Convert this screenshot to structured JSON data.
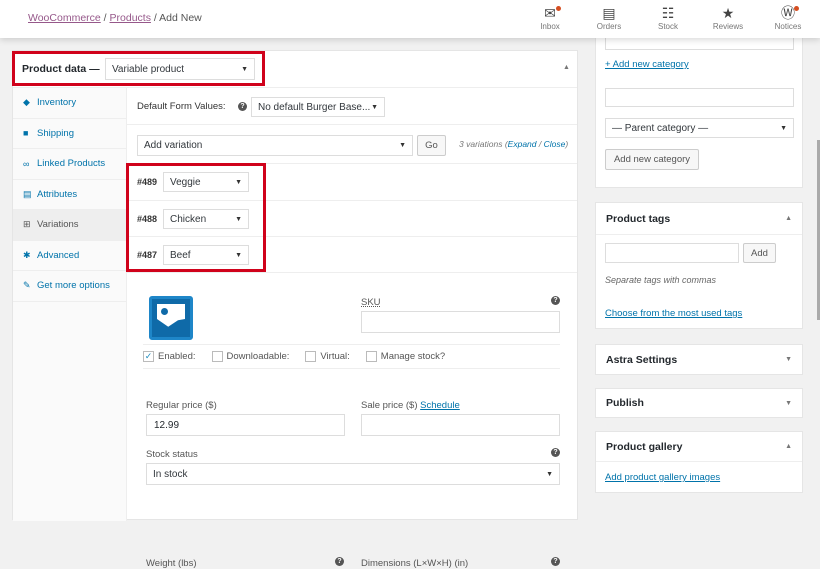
{
  "breadcrumb": {
    "items": [
      "WooCommerce",
      "Products"
    ],
    "current": "Add New"
  },
  "toolbar": [
    {
      "label": "Inbox",
      "icon": "inbox-icon",
      "glyph": "✉"
    },
    {
      "label": "Orders",
      "icon": "orders-icon",
      "glyph": "▤"
    },
    {
      "label": "Stock",
      "icon": "stock-icon",
      "glyph": "☷"
    },
    {
      "label": "Reviews",
      "icon": "star-icon",
      "glyph": "★"
    },
    {
      "label": "Notices",
      "icon": "wordpress-icon",
      "glyph": "Ⓦ"
    }
  ],
  "product_data": {
    "label": "Product data —",
    "type": "Variable product"
  },
  "tabs": [
    {
      "label": "Inventory",
      "glyph": "◆"
    },
    {
      "label": "Shipping",
      "glyph": "■"
    },
    {
      "label": "Linked Products",
      "glyph": "∞"
    },
    {
      "label": "Attributes",
      "glyph": "▤"
    },
    {
      "label": "Variations",
      "glyph": "⊞"
    },
    {
      "label": "Advanced",
      "glyph": "✱"
    },
    {
      "label": "Get more options",
      "glyph": "✎"
    }
  ],
  "variations": {
    "default_label": "Default Form Values:",
    "default_value": "No default Burger Base...",
    "add_select": "Add variation",
    "go": "Go",
    "count": "3 variations (",
    "expand": "Expand",
    "sep": " / ",
    "close": "Close",
    "close_paren": ")",
    "items": [
      {
        "id": "#489",
        "value": "Veggie"
      },
      {
        "id": "#488",
        "value": "Chicken"
      },
      {
        "id": "#487",
        "value": "Beef"
      }
    ]
  },
  "detail": {
    "sku_label": "SKU",
    "sku_value": "",
    "enabled": "Enabled:",
    "downloadable": "Downloadable:",
    "virtual": "Virtual:",
    "manage_stock": "Manage stock?",
    "regular_label": "Regular price ($)",
    "regular_value": "12.99",
    "sale_label": "Sale price ($)",
    "schedule": "Schedule",
    "stock_label": "Stock status",
    "stock_value": "In stock",
    "weight_label": "Weight (lbs)",
    "dimensions_label": "Dimensions (L×W×H) (in)",
    "enabled_checked": true
  },
  "categories": {
    "add_link": "+ Add new category",
    "parent": "— Parent category —",
    "add_button": "Add new category"
  },
  "tags": {
    "title": "Product tags",
    "add": "Add",
    "hint": "Separate tags with commas",
    "choose": "Choose from the most used tags"
  },
  "astra": {
    "title": "Astra Settings"
  },
  "publish": {
    "title": "Publish"
  },
  "gallery": {
    "title": "Product gallery",
    "link": "Add product gallery images"
  }
}
